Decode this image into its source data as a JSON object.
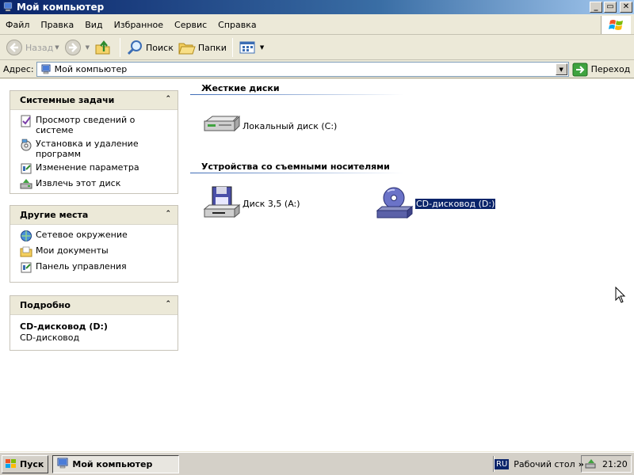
{
  "window": {
    "title": "Мой компьютер",
    "minimize_glyph": "_",
    "maximize_glyph": "▭",
    "close_glyph": "✕"
  },
  "menu": {
    "items": [
      "Файл",
      "Правка",
      "Вид",
      "Избранное",
      "Сервис",
      "Справка"
    ]
  },
  "toolbar": {
    "back_label": "Назад",
    "search_label": "Поиск",
    "folders_label": "Папки"
  },
  "address": {
    "label": "Адрес:",
    "value": "Мой компьютер",
    "go_label": "Переход"
  },
  "system_tasks": {
    "title": "Системные задачи",
    "items": [
      {
        "label": "Просмотр сведений о системе",
        "icon": "system-info-icon"
      },
      {
        "label": "Установка и удаление программ",
        "icon": "add-remove-programs-icon"
      },
      {
        "label": "Изменение параметра",
        "icon": "control-panel-icon"
      },
      {
        "label": "Извлечь этот диск",
        "icon": "eject-disk-icon"
      }
    ]
  },
  "other_places": {
    "title": "Другие места",
    "items": [
      {
        "label": "Сетевое окружение",
        "icon": "network-icon"
      },
      {
        "label": "Мои документы",
        "icon": "documents-icon"
      },
      {
        "label": "Панель управления",
        "icon": "control-panel-icon"
      }
    ]
  },
  "details": {
    "title": "Подробно",
    "name": "CD-дисковод (D:)",
    "type": "CD-дисковод"
  },
  "content": {
    "hard_drives_header": "Жесткие диски",
    "local_disk_label": "Локальный диск (C:)",
    "removable_header": "Устройства со съемными носителями",
    "floppy_label": "Диск 3,5 (A:)",
    "cd_label": "CD-дисковод (D:)"
  },
  "taskbar": {
    "start_label": "Пуск",
    "task_label": "Мой компьютер",
    "lang": "RU",
    "desktop_label": "Рабочий стол",
    "clock": "21:20"
  },
  "colors": {
    "title_bar_start": "#0a246a",
    "title_bar_end": "#a6caf0",
    "selection": "#0a246a",
    "chrome": "#ece9d8"
  }
}
